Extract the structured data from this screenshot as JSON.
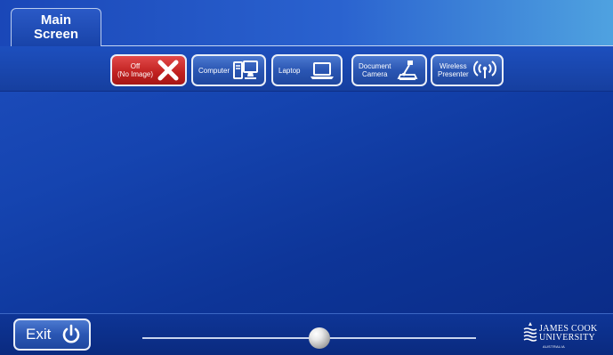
{
  "tabs": [
    {
      "label_line1": "Main",
      "label_line2": "Screen"
    }
  ],
  "sources": [
    {
      "line1": "Off",
      "line2": "(No Image)",
      "icon": "close-icon",
      "color": "#c0201f"
    },
    {
      "line1": "Computer",
      "line2": "",
      "icon": "computer-icon"
    },
    {
      "line1": "Laptop",
      "line2": "",
      "icon": "laptop-icon"
    },
    {
      "line1": "Document",
      "line2": "Camera",
      "icon": "document-camera-icon"
    },
    {
      "line1": "Wireless",
      "line2": "Presenter",
      "icon": "wireless-icon"
    }
  ],
  "footer": {
    "exit_label": "Exit",
    "exit_icon": "power-icon",
    "volume_level": 0.53
  },
  "logo": {
    "line1": "JAMES COOK",
    "line2": "UNIVERSITY",
    "line3": "AUSTRALIA"
  },
  "colors": {
    "accent": "#1a47b8",
    "off_button": "#c0201f"
  }
}
